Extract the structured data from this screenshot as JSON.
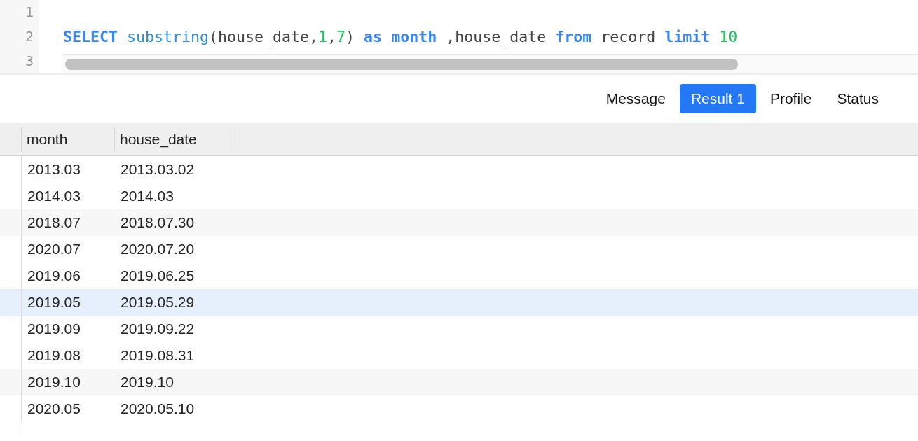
{
  "editor": {
    "lines": [
      {
        "number": "1"
      },
      {
        "number": "2",
        "tokens": [
          {
            "kind": "keyword",
            "text": "SELECT "
          },
          {
            "kind": "function",
            "text": "substring"
          },
          {
            "kind": "plain",
            "text": "(house_date,"
          },
          {
            "kind": "number",
            "text": "1"
          },
          {
            "kind": "plain",
            "text": ","
          },
          {
            "kind": "number",
            "text": "7"
          },
          {
            "kind": "plain",
            "text": ") "
          },
          {
            "kind": "keyword",
            "text": "as "
          },
          {
            "kind": "keyword",
            "text": "month"
          },
          {
            "kind": "plain",
            "text": " ,house_date "
          },
          {
            "kind": "keyword",
            "text": "from"
          },
          {
            "kind": "plain",
            "text": " record "
          },
          {
            "kind": "keyword",
            "text": "limit "
          },
          {
            "kind": "number",
            "text": "10"
          }
        ]
      },
      {
        "number": "3"
      }
    ]
  },
  "tabs": [
    {
      "label": "Message",
      "selected": false
    },
    {
      "label": "Result 1",
      "selected": true
    },
    {
      "label": "Profile",
      "selected": false
    },
    {
      "label": "Status",
      "selected": false
    }
  ],
  "table": {
    "columns": [
      "month",
      "house_date"
    ],
    "rows": [
      {
        "cells": [
          "2013.03",
          "2013.03.02"
        ],
        "selected": false
      },
      {
        "cells": [
          "2014.03",
          "2014.03"
        ],
        "selected": false
      },
      {
        "cells": [
          "2018.07",
          "2018.07.30"
        ],
        "selected": false
      },
      {
        "cells": [
          "2020.07",
          "2020.07.20"
        ],
        "selected": false
      },
      {
        "cells": [
          "2019.06",
          "2019.06.25"
        ],
        "selected": false
      },
      {
        "cells": [
          "2019.05",
          "2019.05.29"
        ],
        "selected": true
      },
      {
        "cells": [
          "2019.09",
          "2019.09.22"
        ],
        "selected": false
      },
      {
        "cells": [
          "2019.08",
          "2019.08.31"
        ],
        "selected": false
      },
      {
        "cells": [
          "2019.10",
          "2019.10"
        ],
        "selected": false
      },
      {
        "cells": [
          "2020.05",
          "2020.05.10"
        ],
        "selected": false
      }
    ]
  }
}
